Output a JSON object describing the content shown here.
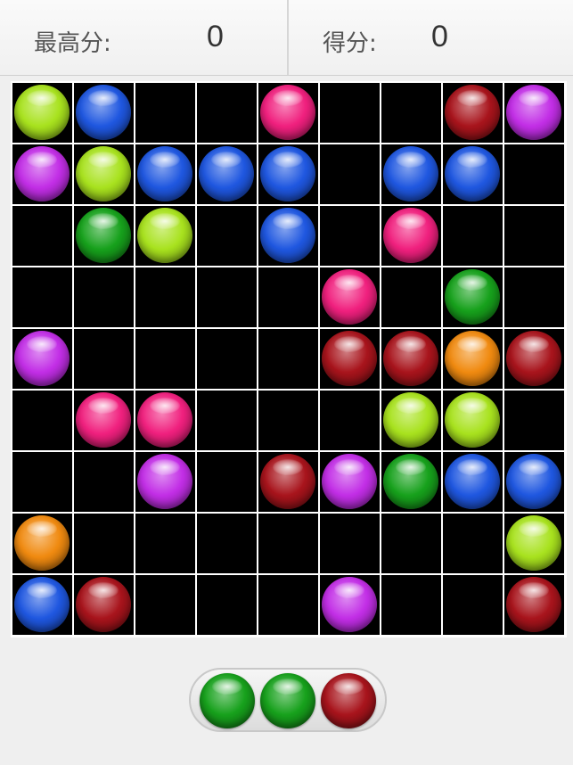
{
  "header": {
    "best_label": "最高分:",
    "best_value": "0",
    "score_label": "得分:",
    "score_value": "0"
  },
  "colors": {
    "lime": "#a8e21e",
    "blue": "#1f57e0",
    "pink": "#f0207e",
    "red": "#a8141c",
    "purple": "#c22ee6",
    "green": "#17a11c",
    "orange": "#f08a10"
  },
  "board": {
    "rows": 9,
    "cols": 9,
    "cells": [
      [
        "lime",
        "blue",
        "",
        "",
        "pink",
        "",
        "",
        "red",
        "purple"
      ],
      [
        "purple",
        "lime",
        "blue",
        "blue",
        "blue",
        "",
        "blue",
        "blue",
        ""
      ],
      [
        "",
        "green",
        "lime",
        "",
        "blue",
        "",
        "pink",
        "",
        ""
      ],
      [
        "",
        "",
        "",
        "",
        "",
        "pink",
        "",
        "green",
        ""
      ],
      [
        "purple",
        "",
        "",
        "",
        "",
        "red",
        "red",
        "orange",
        "red"
      ],
      [
        "",
        "pink",
        "pink",
        "",
        "",
        "",
        "lime",
        "lime",
        ""
      ],
      [
        "",
        "",
        "purple",
        "",
        "red",
        "purple",
        "green",
        "blue",
        "blue"
      ],
      [
        "orange",
        "",
        "",
        "",
        "",
        "",
        "",
        "",
        "lime"
      ],
      [
        "blue",
        "red",
        "",
        "",
        "",
        "purple",
        "",
        "",
        "red"
      ]
    ]
  },
  "next_balls": [
    "green",
    "green",
    "red"
  ]
}
